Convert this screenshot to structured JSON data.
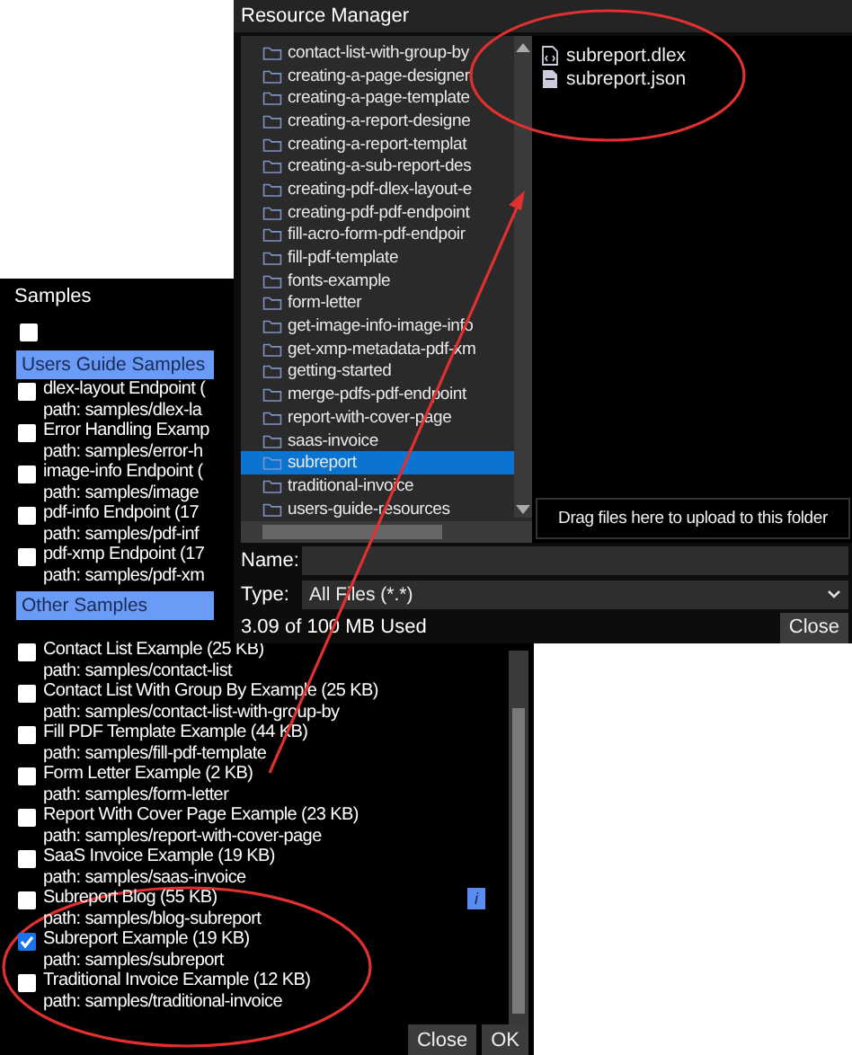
{
  "samples": {
    "title": "Samples",
    "select_all": {
      "checked": false
    },
    "groups": [
      {
        "label": "Users Guide Samples",
        "items": [
          {
            "name": "dlex-layout Endpoint (",
            "path": "path: samples/dlex-la",
            "checked": false
          },
          {
            "name": "Error Handling Examp",
            "path": "path: samples/error-h",
            "checked": false
          },
          {
            "name": "image-info Endpoint (",
            "path": "path: samples/image",
            "checked": false
          },
          {
            "name": "pdf-info Endpoint (17",
            "path": "path: samples/pdf-inf",
            "checked": false
          },
          {
            "name": "pdf-xmp Endpoint (17",
            "path": "path: samples/pdf-xm",
            "checked": false
          }
        ]
      },
      {
        "label": "Other Samples",
        "items": [
          {
            "name": "Contact List Example (25 KB)",
            "path": "path: samples/contact-list",
            "checked": false
          },
          {
            "name": "Contact List With Group By Example (25 KB)",
            "path": "path: samples/contact-list-with-group-by",
            "checked": false
          },
          {
            "name": "Fill PDF Template Example (44 KB)",
            "path": "path: samples/fill-pdf-template",
            "checked": false
          },
          {
            "name": "Form Letter Example (2 KB)",
            "path": "path: samples/form-letter",
            "checked": false
          },
          {
            "name": "Report With Cover Page Example (23 KB)",
            "path": "path: samples/report-with-cover-page",
            "checked": false
          },
          {
            "name": "SaaS Invoice Example (19 KB)",
            "path": "path: samples/saas-invoice",
            "checked": false
          },
          {
            "name": "Subreport Blog (55 KB)",
            "path": "path: samples/blog-subreport",
            "checked": false,
            "info": "i"
          },
          {
            "name": "Subreport Example (19 KB)",
            "path": "path: samples/subreport",
            "checked": true
          },
          {
            "name": "Traditional Invoice Example (12 KB)",
            "path": "path: samples/traditional-invoice",
            "checked": false
          }
        ]
      }
    ],
    "buttons": [
      "Close",
      "OK"
    ]
  },
  "resource_manager": {
    "title": "Resource Manager",
    "tree": [
      {
        "label": "contact-list-with-group-by",
        "selected": false
      },
      {
        "label": "creating-a-page-designer",
        "selected": false
      },
      {
        "label": "creating-a-page-template",
        "selected": false
      },
      {
        "label": "creating-a-report-designe",
        "selected": false
      },
      {
        "label": "creating-a-report-templat",
        "selected": false
      },
      {
        "label": "creating-a-sub-report-des",
        "selected": false
      },
      {
        "label": "creating-pdf-dlex-layout-e",
        "selected": false
      },
      {
        "label": "creating-pdf-pdf-endpoint",
        "selected": false
      },
      {
        "label": "fill-acro-form-pdf-endpoir",
        "selected": false
      },
      {
        "label": "fill-pdf-template",
        "selected": false
      },
      {
        "label": "fonts-example",
        "selected": false
      },
      {
        "label": "form-letter",
        "selected": false
      },
      {
        "label": "get-image-info-image-info",
        "selected": false
      },
      {
        "label": "get-xmp-metadata-pdf-xm",
        "selected": false
      },
      {
        "label": "getting-started",
        "selected": false
      },
      {
        "label": "merge-pdfs-pdf-endpoint",
        "selected": false
      },
      {
        "label": "report-with-cover-page",
        "selected": false
      },
      {
        "label": "saas-invoice",
        "selected": false
      },
      {
        "label": "subreport",
        "selected": true
      },
      {
        "label": "traditional-invoice",
        "selected": false
      },
      {
        "label": "users-guide-resources",
        "selected": false
      }
    ],
    "files": [
      {
        "name": "subreport.dlex",
        "kind": "code"
      },
      {
        "name": "subreport.json",
        "kind": "data"
      }
    ],
    "drop_zone": "Drag files here to upload to this folder",
    "name_label": "Name:",
    "type_label": "Type:",
    "type_value": "All Files (*.*)",
    "usage": "3.09 of 100 MB Used",
    "close": "Close"
  }
}
